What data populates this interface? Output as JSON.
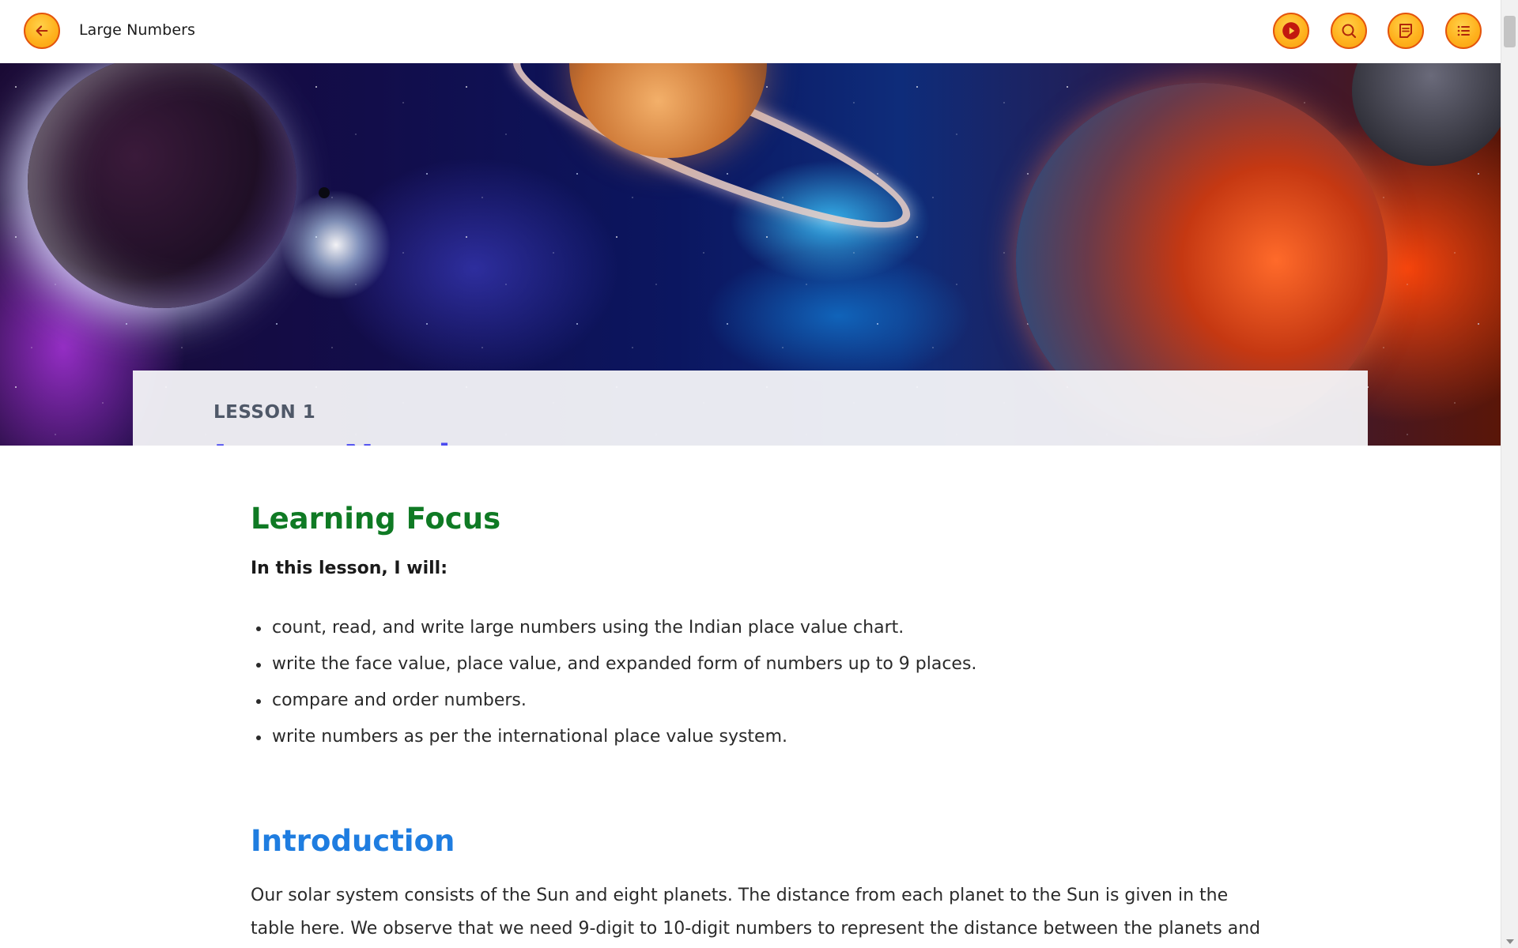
{
  "header": {
    "title": "Large Numbers",
    "back_icon": "arrow-left-icon",
    "actions": [
      {
        "name": "play",
        "icon": "play-icon"
      },
      {
        "name": "search",
        "icon": "search-icon"
      },
      {
        "name": "notes",
        "icon": "notes-icon"
      },
      {
        "name": "table_of_contents",
        "icon": "list-icon"
      }
    ],
    "accent_color": "#ffb21e",
    "border_color": "#e4540c"
  },
  "banner": {
    "lesson_label": "LESSON 1",
    "lesson_title": "Large Numbers",
    "title_color": "#4b4bf0"
  },
  "learning_focus": {
    "heading": "Learning Focus",
    "lead": "In this lesson, I will:",
    "items": [
      "count, read, and write large numbers using the Indian place value chart.",
      "write the face value, place value, and expanded form of numbers up to 9 places.",
      "compare and order numbers.",
      "write numbers as per the international place value system."
    ],
    "heading_color": "#0f7a24"
  },
  "introduction": {
    "heading": "Introduction",
    "text": "Our solar system consists of the Sun and eight planets. The distance from each planet to the Sun is given in the table here. We observe that we need 9-digit to 10-digit numbers to represent the distance between the planets and the Sun. In this",
    "heading_color": "#1f7de0"
  }
}
